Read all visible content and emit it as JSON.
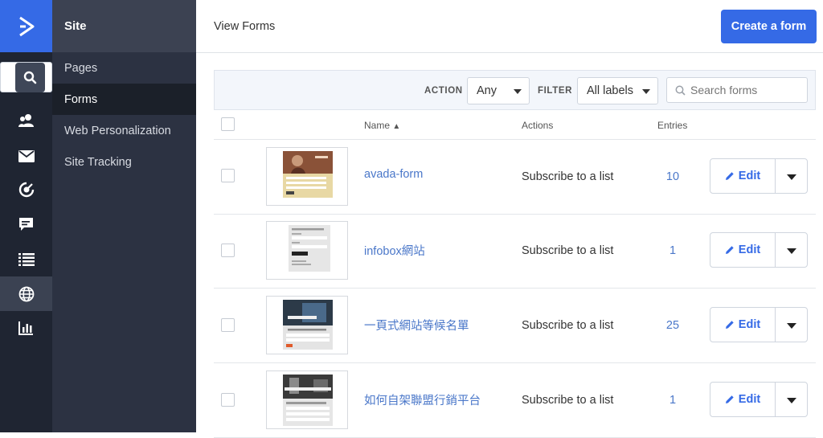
{
  "app": {
    "accent": "#356ae6",
    "link": "#4a77c9"
  },
  "rail": {
    "icons": [
      "logo-chevron-icon",
      "search-icon",
      "contacts-icon",
      "mail-icon",
      "automation-icon",
      "chat-icon",
      "lists-icon",
      "globe-icon",
      "reports-icon"
    ]
  },
  "sidebar": {
    "title": "Site",
    "items": [
      {
        "label": "Pages"
      },
      {
        "label": "Forms"
      },
      {
        "label": "Web Personalization"
      },
      {
        "label": "Site Tracking"
      }
    ]
  },
  "header": {
    "title": "View Forms",
    "create_label": "Create a form"
  },
  "filters": {
    "action_label": "ACTION",
    "action_value": "Any",
    "filter_label": "FILTER",
    "filter_value": "All labels",
    "search_placeholder": "Search forms"
  },
  "table": {
    "columns": {
      "name": "Name",
      "actions": "Actions",
      "entries": "Entries"
    },
    "sort_indicator": "▲",
    "edit_label": "Edit",
    "rows": [
      {
        "name": "avada-form",
        "action": "Subscribe to a list",
        "entries": "10"
      },
      {
        "name": "infobox網站",
        "action": "Subscribe to a list",
        "entries": "1"
      },
      {
        "name": "一頁式網站等候名單",
        "action": "Subscribe to a list",
        "entries": "25"
      },
      {
        "name": "如何自架聯盟行銷平台",
        "action": "Subscribe to a list",
        "entries": "1"
      }
    ]
  }
}
